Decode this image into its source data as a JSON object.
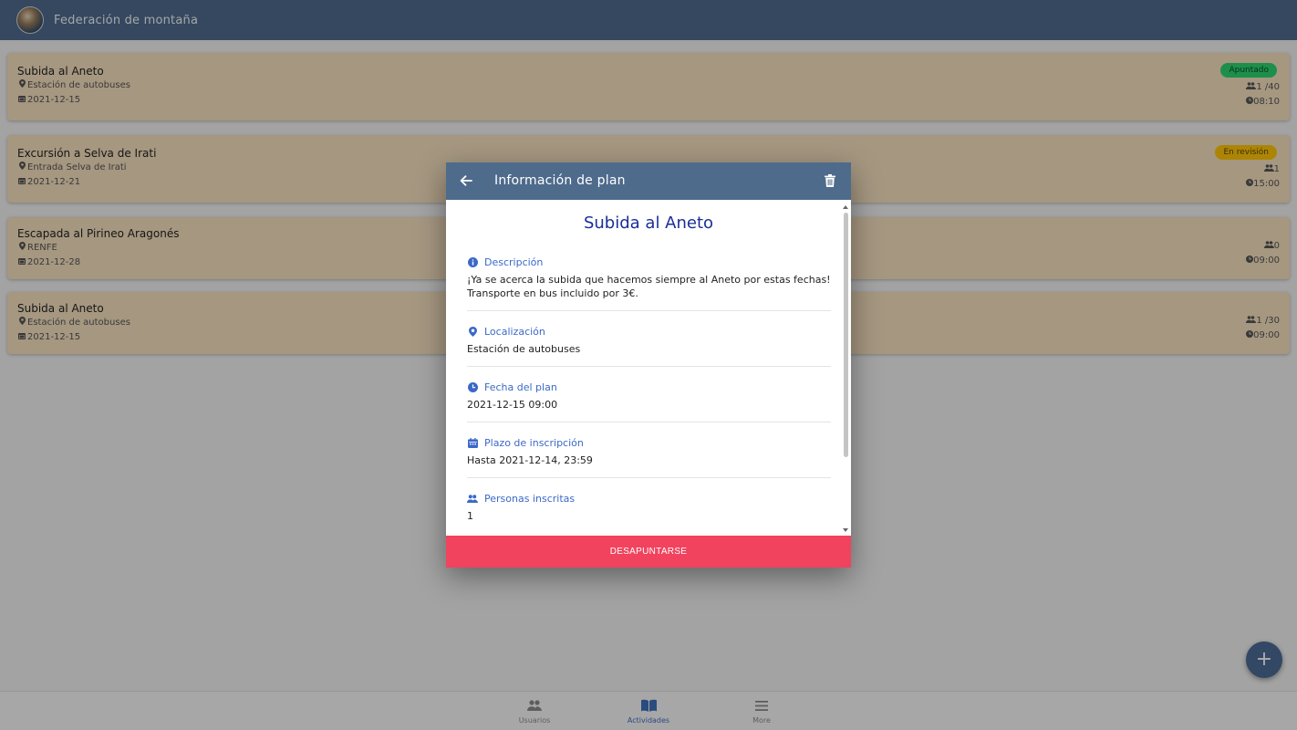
{
  "header": {
    "title": "Federación de montaña"
  },
  "activities": [
    {
      "title": "Subida al Aneto",
      "location": "Estación de autobuses",
      "date": "2021-12-15",
      "badge": "Apuntado",
      "participants": "1 /40",
      "time": "08:10"
    },
    {
      "title": "Excursión a Selva de Irati",
      "location": "Entrada Selva de Irati",
      "date": "2021-12-21",
      "badge": "En revisión",
      "participants": "1",
      "time": "15:00"
    },
    {
      "title": "Escapada al Pirineo Aragonés",
      "location": "RENFE",
      "date": "2021-12-28",
      "badge": "",
      "participants": "0",
      "time": "09:00"
    },
    {
      "title": "Subida al Aneto",
      "location": "Estación de autobuses",
      "date": "2021-12-15",
      "badge": "",
      "participants": "1 /30",
      "time": "09:00"
    }
  ],
  "modal": {
    "header_title": "Información de plan",
    "plan_title": "Subida al Aneto",
    "sections": [
      {
        "label": "Descripción",
        "text": "¡Ya se acerca la subida que hacemos siempre al Aneto por estas fechas! Transporte en bus incluido por 3€."
      },
      {
        "label": "Localización",
        "text": "Estación de autobuses"
      },
      {
        "label": "Fecha del plan",
        "text": "2021-12-15 09:00"
      },
      {
        "label": "Plazo de inscripción",
        "text": "Hasta 2021-12-14, 23:59"
      },
      {
        "label": "Personas inscritas",
        "text": "1"
      }
    ],
    "action_label": "DESAPUNTARSE"
  },
  "fab": {
    "label": "+"
  },
  "tabs": [
    {
      "label": "Usuarios",
      "icon": "people-icon"
    },
    {
      "label": "Actividades",
      "icon": "book-icon",
      "active": true
    },
    {
      "label": "More",
      "icon": "menu-icon"
    }
  ],
  "colors": {
    "header": "#4e6b8c",
    "card": "#f4dfbd",
    "badge_joined": "#2dd36f",
    "badge_review": "#ffc409",
    "action": "#f1435e",
    "plan_title": "#1a2d99",
    "section_label": "#3b69c8",
    "active_tab": "#3f6fba"
  }
}
